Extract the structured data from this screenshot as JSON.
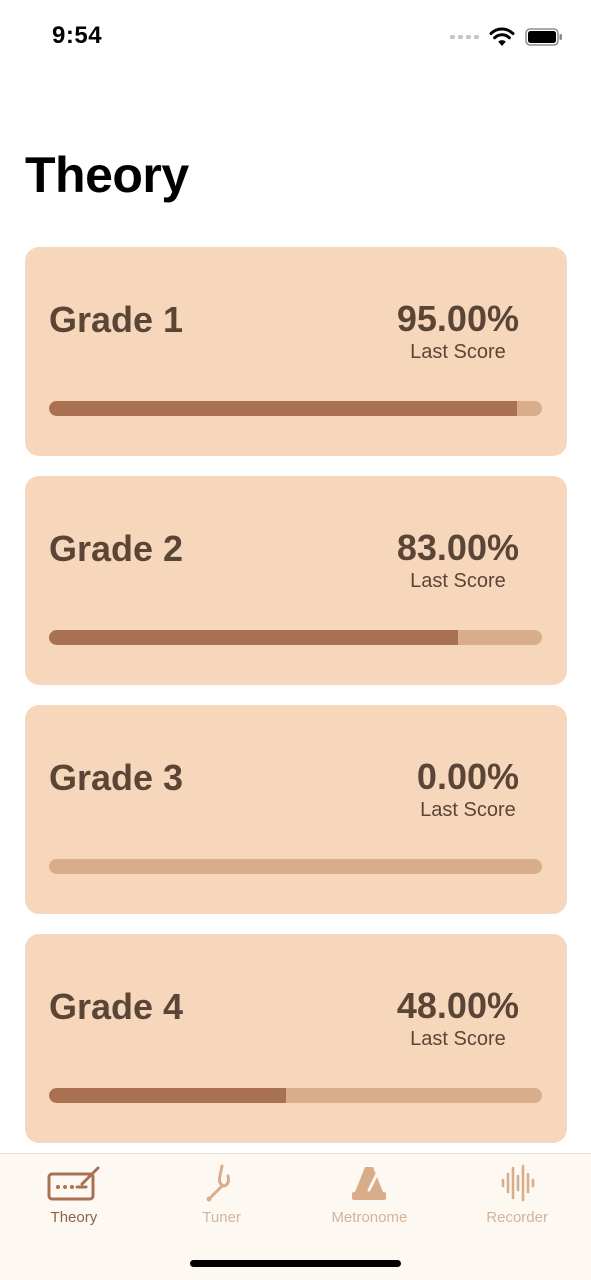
{
  "status_bar": {
    "time": "9:54"
  },
  "page": {
    "title": "Theory"
  },
  "grades": [
    {
      "name": "Grade 1",
      "score": "95.00%",
      "score_label": "Last Score",
      "progress": 0.95
    },
    {
      "name": "Grade 2",
      "score": "83.00%",
      "score_label": "Last Score",
      "progress": 0.83
    },
    {
      "name": "Grade 3",
      "score": "0.00%",
      "score_label": "Last Score",
      "progress": 0.0
    },
    {
      "name": "Grade 4",
      "score": "48.00%",
      "score_label": "Last Score",
      "progress": 0.48
    }
  ],
  "tab_bar": {
    "tabs": [
      {
        "label": "Theory",
        "icon": "theory-icon",
        "active": true
      },
      {
        "label": "Tuner",
        "icon": "tuning-fork-icon",
        "active": false
      },
      {
        "label": "Metronome",
        "icon": "metronome-icon",
        "active": false
      },
      {
        "label": "Recorder",
        "icon": "waveform-icon",
        "active": false
      }
    ]
  },
  "colors": {
    "card_background": "#f6d7bb",
    "progress_fill": "#a87252",
    "progress_track": "#d9ad8a",
    "text": "#5b4536",
    "tab_active": "#8a6347",
    "tab_inactive": "#d3b49b"
  }
}
